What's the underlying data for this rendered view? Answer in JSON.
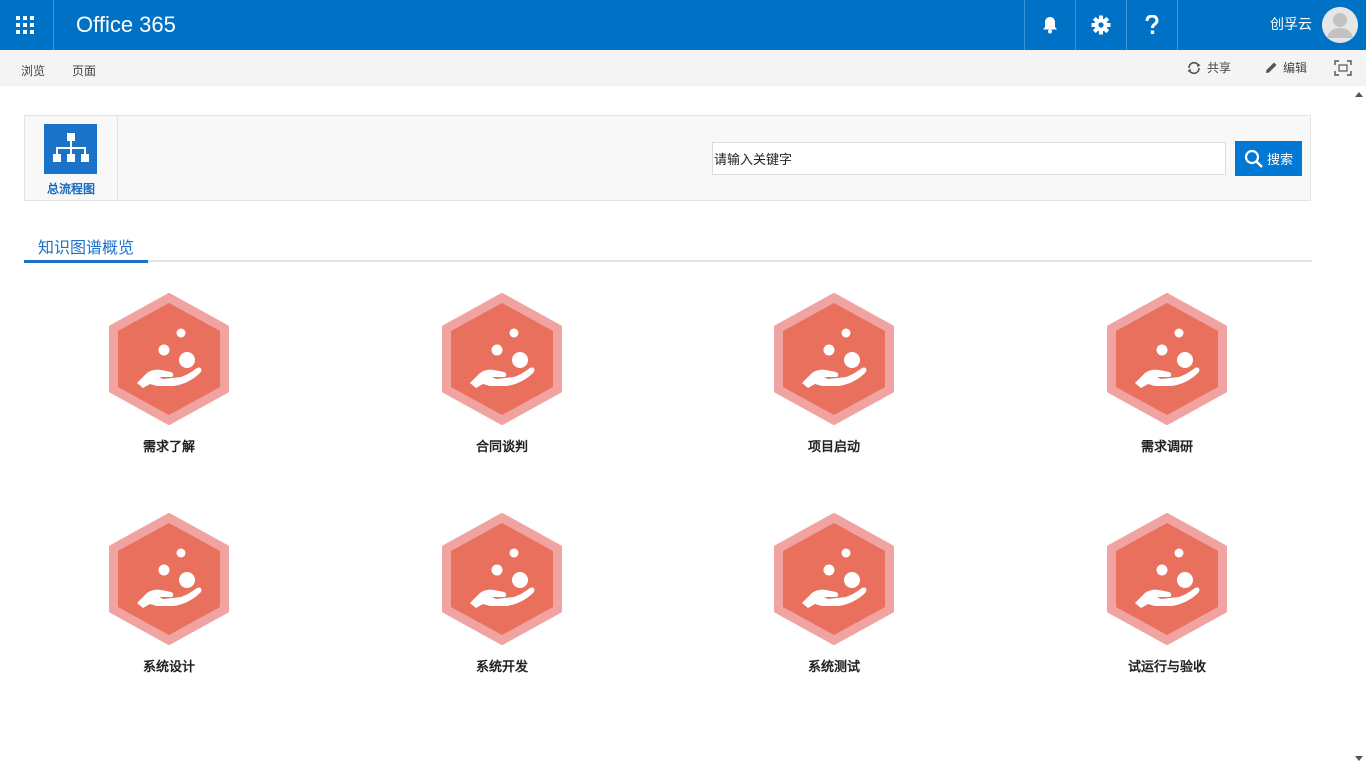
{
  "suitebar": {
    "app_title": "Office 365",
    "user_name": "创孚云",
    "accent_color": "#0072c6"
  },
  "ribbon": {
    "tabs": [
      "浏览",
      "页面"
    ],
    "share_label": "共享",
    "edit_label": "编辑"
  },
  "header": {
    "flow_label": "总流程图",
    "search_value": "请输入关键字",
    "search_button_label": "搜索"
  },
  "section": {
    "tab_label": "知识图谱概览"
  },
  "tiles": [
    {
      "label": "需求了解",
      "icon": "hand-with-coins-icon"
    },
    {
      "label": "合同谈判",
      "icon": "hand-with-coins-icon"
    },
    {
      "label": "项目启动",
      "icon": "hand-with-coins-icon"
    },
    {
      "label": "需求调研",
      "icon": "hand-with-coins-icon"
    },
    {
      "label": "系统设计",
      "icon": "hand-with-coins-icon"
    },
    {
      "label": "系统开发",
      "icon": "hand-with-coins-icon"
    },
    {
      "label": "系统测试",
      "icon": "hand-with-coins-icon"
    },
    {
      "label": "试运行与验收",
      "icon": "hand-with-coins-icon"
    }
  ],
  "colors": {
    "hex_fill": "#e8705c",
    "hex_border": "#f0a3a0"
  }
}
